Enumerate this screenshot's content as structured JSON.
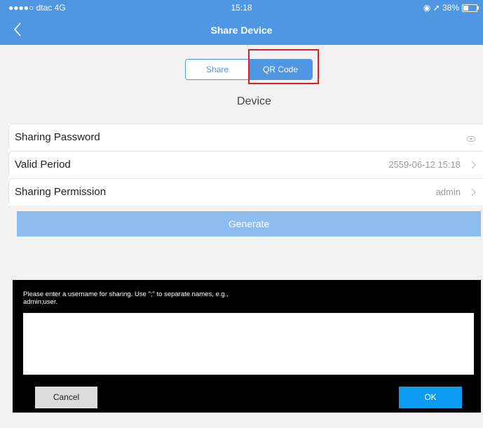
{
  "status_bar": {
    "carrier": "●●●●○ dtac  4G",
    "time": "15:18",
    "right": "◉ ➚ 38%"
  },
  "nav": {
    "title": "Share Device",
    "back_icon": "chevron-left-icon"
  },
  "segment": {
    "share_label": "Share",
    "qr_label": "QR Code",
    "selected": "QR Code"
  },
  "device_label": "Device",
  "settings": {
    "sharing_password": {
      "label": "Sharing Password",
      "icon": "eye-icon"
    },
    "valid_period": {
      "label": "Valid Period",
      "value": "2559-06-12 15:18"
    },
    "sharing_permission": {
      "label": "Sharing Permission",
      "value": "admin"
    }
  },
  "generate_label": "Generate",
  "dialog": {
    "prompt": "Please enter a username for sharing. Use \";\" to separate names, e.g., admin;user.",
    "input_value": "",
    "cancel_label": "Cancel",
    "ok_label": "OK"
  },
  "colors": {
    "accent": "#5097e3",
    "generate": "#8fbcef",
    "ok": "#0a9cf2",
    "highlight": "#e02020"
  }
}
